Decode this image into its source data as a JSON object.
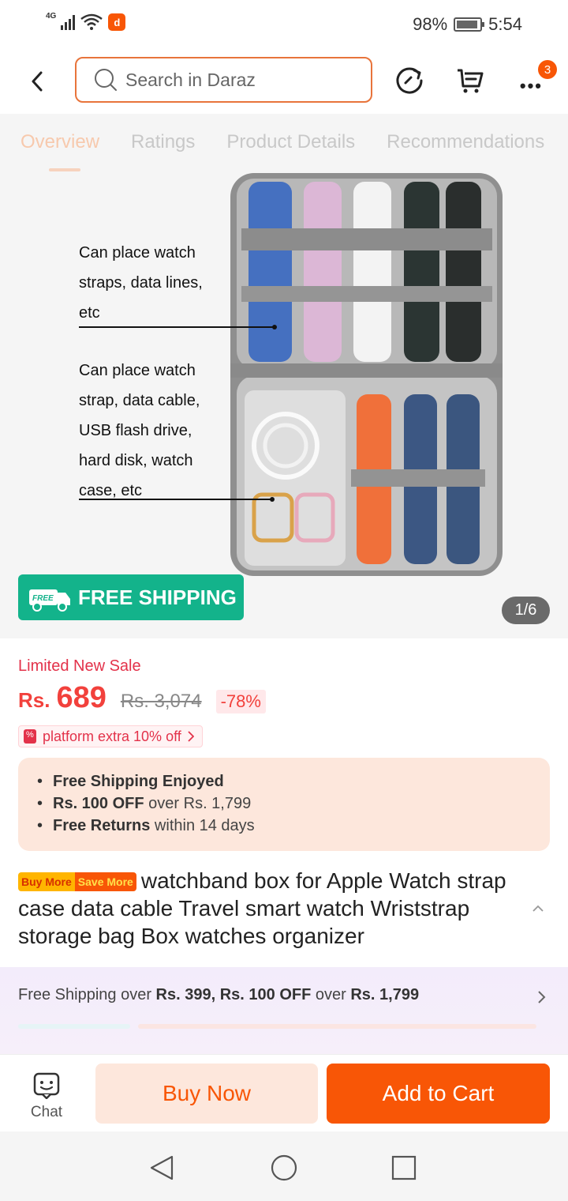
{
  "status_bar": {
    "network": "4G",
    "battery": "98%",
    "time": "5:54"
  },
  "header": {
    "search_placeholder": "Search in Daraz",
    "cart_count": "3",
    "icons": [
      "back-icon",
      "search-icon",
      "share-icon",
      "cart-icon",
      "more-icon"
    ]
  },
  "tabs": [
    "Overview",
    "Ratings",
    "Product Details",
    "Recommendations"
  ],
  "gallery": {
    "callout_1": [
      "Can place watch",
      "straps, data lines,",
      "etc"
    ],
    "callout_2": [
      "Can place watch",
      "strap, data cable,",
      "USB flash drive,",
      "hard disk, watch",
      "case, etc"
    ],
    "free_shipping_badge": "FREE SHIPPING",
    "free_tag": "FREE",
    "pager": "1/6"
  },
  "price": {
    "label": "Limited New Sale",
    "currency": "Rs.",
    "current": "689",
    "original": "Rs. 3,074",
    "discount": "-78%",
    "voucher": "platform extra 10% off"
  },
  "perks": [
    {
      "bold": "Free Shipping Enjoyed",
      "rest": ""
    },
    {
      "bold": "Rs. 100 OFF",
      "rest": " over Rs. 1,799"
    },
    {
      "bold": "Free Returns",
      "rest": " within 14 days"
    }
  ],
  "title": {
    "tag_a": "Buy More",
    "tag_b": "Save More",
    "text": "watchband box for Apple Watch strap case data cable Travel smart watch Wriststrap storage bag Box watches organizer"
  },
  "promo": {
    "p1": "Free Shipping over ",
    "b1": "Rs. 399, Rs. 100 OFF",
    "p2": " over ",
    "b2": "Rs. 1,799"
  },
  "actions": {
    "chat": "Chat",
    "buy_now": "Buy Now",
    "add_to_cart": "Add to Cart"
  },
  "colors": {
    "brand": "#f85606",
    "price": "#f2413c",
    "free_ship": "#13b38b"
  }
}
